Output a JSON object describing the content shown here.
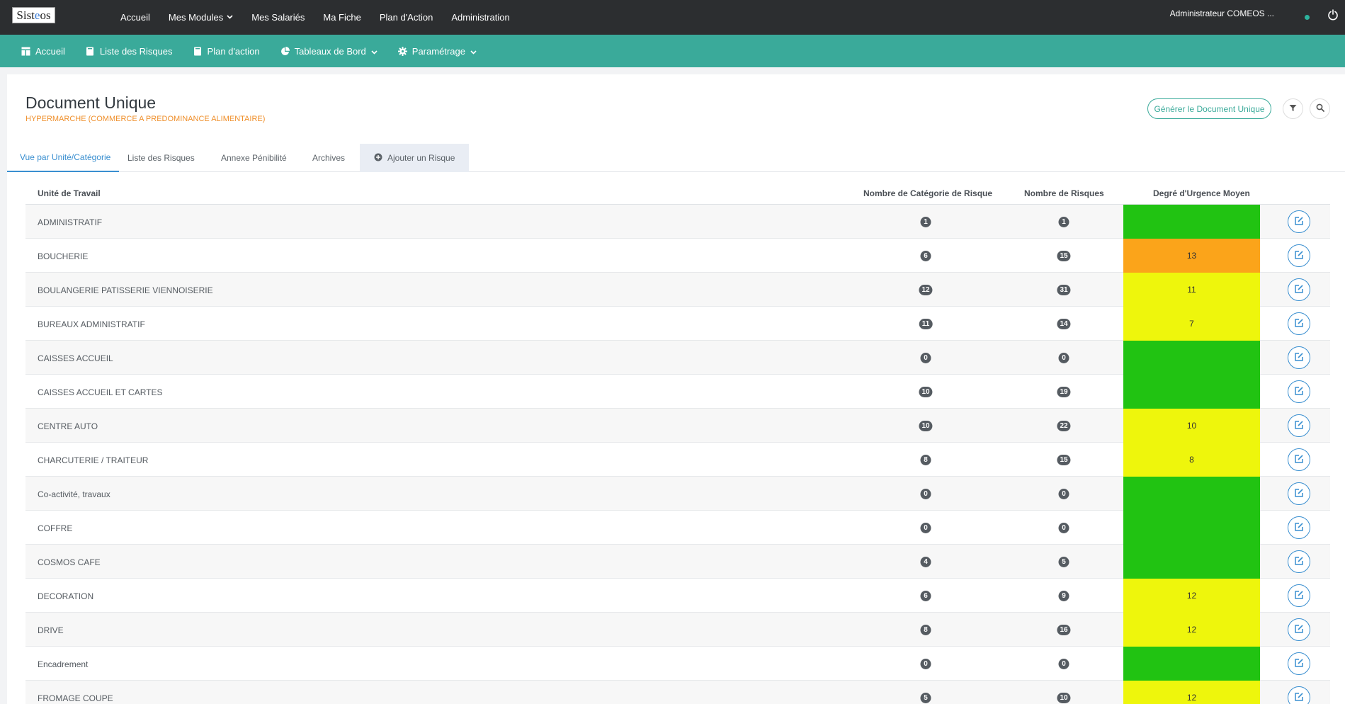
{
  "topbar": {
    "logo_text_a": "Sist",
    "logo_text_b": "e",
    "logo_text_c": "os",
    "nav": [
      {
        "label": "Accueil",
        "has_chevron": false
      },
      {
        "label": "Mes Modules",
        "has_chevron": true
      },
      {
        "label": "Mes Salariés",
        "has_chevron": false
      },
      {
        "label": "Ma Fiche",
        "has_chevron": false
      },
      {
        "label": "Plan d'Action",
        "has_chevron": false
      },
      {
        "label": "Administration",
        "has_chevron": false
      }
    ],
    "user_label": "Administrateur COMEOS ...",
    "status_color": "#2db39e",
    "power_icon": "power-icon"
  },
  "subbar": {
    "items": [
      {
        "label": "Accueil",
        "icon": "dashboard-icon",
        "has_chevron": false
      },
      {
        "label": "Liste des Risques",
        "icon": "book-icon",
        "has_chevron": false
      },
      {
        "label": "Plan d'action",
        "icon": "book-icon",
        "has_chevron": false
      },
      {
        "label": "Tableaux de Bord",
        "icon": "pie-chart-icon",
        "has_chevron": true
      },
      {
        "label": "Paramétrage",
        "icon": "gear-icon",
        "has_chevron": true
      }
    ]
  },
  "page": {
    "title": "Document Unique",
    "subtitle": "HYPERMARCHE (COMMERCE A PREDOMINANCE ALIMENTAIRE)",
    "generate_label": "Générer le Document Unique"
  },
  "tabs": [
    {
      "label": "Vue par Unité/Catégorie",
      "active": true
    },
    {
      "label": "Liste des Risques",
      "active": false
    },
    {
      "label": "Annexe Pénibilité",
      "active": false
    },
    {
      "label": "Archives",
      "active": false
    },
    {
      "label": "Ajouter un Risque",
      "active": false,
      "icon": "plus-circle-icon"
    }
  ],
  "table": {
    "headers": {
      "unit": "Unité de Travail",
      "categories": "Nombre de Catégorie de Risque",
      "risks": "Nombre de Risques",
      "urgency": "Degré d'Urgence Moyen"
    },
    "colors": {
      "green": "#21c312",
      "orange": "#fba41a",
      "yellow": "#eef60c"
    },
    "rows": [
      {
        "unit": "ADMINISTRATIF",
        "categories": "1",
        "risks": "1",
        "urgency": "",
        "level": "green"
      },
      {
        "unit": "BOUCHERIE",
        "categories": "6",
        "risks": "15",
        "urgency": "13",
        "level": "orange"
      },
      {
        "unit": "BOULANGERIE PATISSERIE VIENNOISERIE",
        "categories": "12",
        "risks": "31",
        "urgency": "11",
        "level": "yellow"
      },
      {
        "unit": "BUREAUX ADMINISTRATIF",
        "categories": "11",
        "risks": "14",
        "urgency": "7",
        "level": "yellow"
      },
      {
        "unit": "CAISSES ACCUEIL",
        "categories": "0",
        "risks": "0",
        "urgency": "",
        "level": "green"
      },
      {
        "unit": "CAISSES ACCUEIL ET CARTES",
        "categories": "10",
        "risks": "19",
        "urgency": "",
        "level": "green"
      },
      {
        "unit": "CENTRE AUTO",
        "categories": "10",
        "risks": "22",
        "urgency": "10",
        "level": "yellow"
      },
      {
        "unit": "CHARCUTERIE / TRAITEUR",
        "categories": "8",
        "risks": "15",
        "urgency": "8",
        "level": "yellow"
      },
      {
        "unit": "Co-activité, travaux",
        "categories": "0",
        "risks": "0",
        "urgency": "",
        "level": "green"
      },
      {
        "unit": "COFFRE",
        "categories": "0",
        "risks": "0",
        "urgency": "",
        "level": "green"
      },
      {
        "unit": "COSMOS CAFE",
        "categories": "4",
        "risks": "5",
        "urgency": "",
        "level": "green"
      },
      {
        "unit": "DECORATION",
        "categories": "6",
        "risks": "9",
        "urgency": "12",
        "level": "yellow"
      },
      {
        "unit": "DRIVE",
        "categories": "8",
        "risks": "16",
        "urgency": "12",
        "level": "yellow"
      },
      {
        "unit": "Encadrement",
        "categories": "0",
        "risks": "0",
        "urgency": "",
        "level": "green"
      },
      {
        "unit": "FROMAGE COUPE",
        "categories": "5",
        "risks": "10",
        "urgency": "12",
        "level": "yellow"
      }
    ]
  }
}
